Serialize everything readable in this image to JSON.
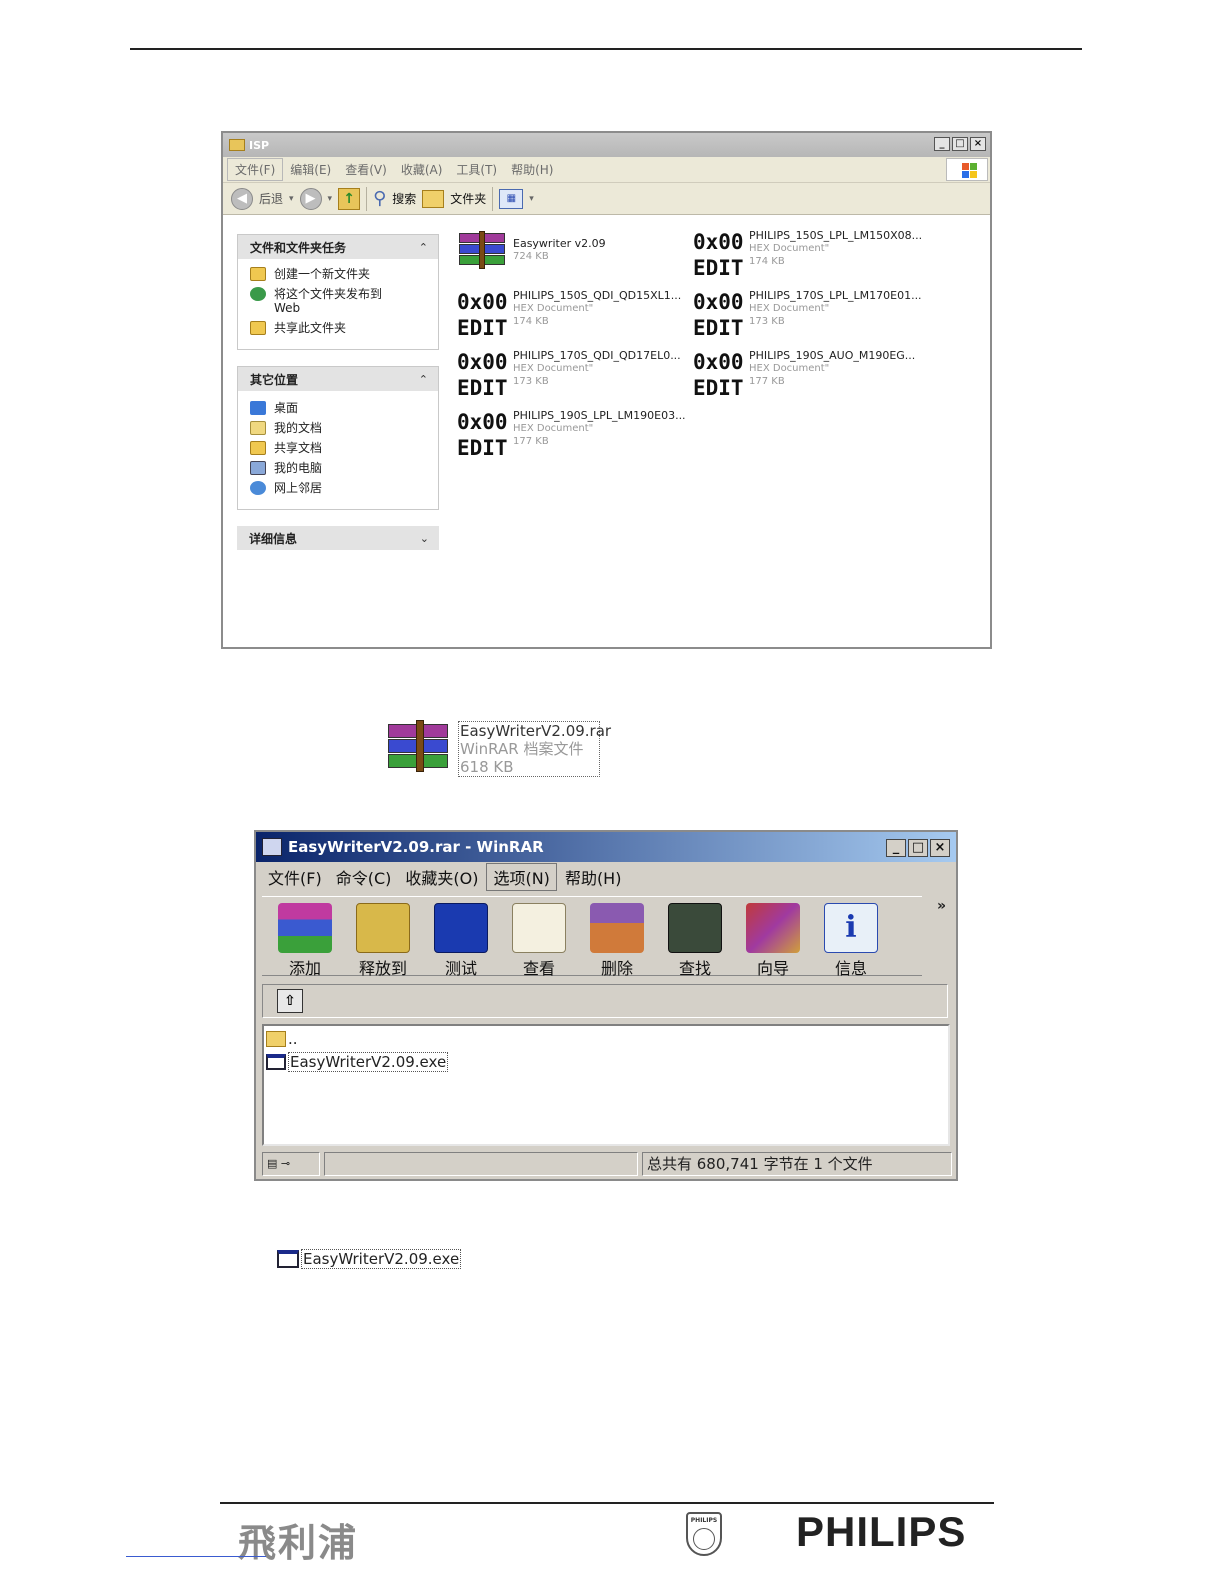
{
  "explorer": {
    "title": "ISP",
    "menu": [
      "文件(F)",
      "编辑(E)",
      "查看(V)",
      "收藏(A)",
      "工具(T)",
      "帮助(H)"
    ],
    "toolbar": {
      "back": "后退",
      "search": "搜索",
      "folders": "文件夹"
    },
    "panels": {
      "tasks": {
        "header": "文件和文件夹任务",
        "items": [
          "创建一个新文件夹",
          "将这个文件夹发布到",
          "Web",
          "共享此文件夹"
        ]
      },
      "places": {
        "header": "其它位置",
        "items": [
          "桌面",
          "我的文档",
          "共享文档",
          "我的电脑",
          "网上邻居"
        ]
      },
      "details": {
        "header": "详细信息"
      }
    },
    "hex_icon": {
      "top": "0x00",
      "bottom": "EDIT"
    },
    "files": [
      {
        "name": "Easywriter v2.09",
        "type": "",
        "size": "724 KB",
        "icon": "winrar-icon"
      },
      {
        "name": "PHILIPS_150S_LPL_LM150X08...",
        "type": "HEX Document\"",
        "size": "174 KB",
        "icon": "hex-icon"
      },
      {
        "name": "PHILIPS_150S_QDI_QD15XL1...",
        "type": "HEX Document\"",
        "size": "174 KB",
        "icon": "hex-icon"
      },
      {
        "name": "PHILIPS_170S_LPL_LM170E01...",
        "type": "HEX Document\"",
        "size": "173 KB",
        "icon": "hex-icon"
      },
      {
        "name": "PHILIPS_170S_QDI_QD17EL0...",
        "type": "HEX Document\"",
        "size": "173 KB",
        "icon": "hex-icon"
      },
      {
        "name": "PHILIPS_190S_AUO_M190EG...",
        "type": "HEX Document\"",
        "size": "177 KB",
        "icon": "hex-icon"
      },
      {
        "name": "PHILIPS_190S_LPL_LM190E03...",
        "type": "HEX Document\"",
        "size": "177 KB",
        "icon": "hex-icon"
      }
    ]
  },
  "rar_file": {
    "name": "EasyWriterV2.09.rar",
    "type": "WinRAR 档案文件",
    "size": "618 KB"
  },
  "winrar": {
    "title": "EasyWriterV2.09.rar - WinRAR",
    "menu": [
      "文件(F)",
      "命令(C)",
      "收藏夹(O)",
      "选项(N)",
      "帮助(H)"
    ],
    "toolbar": [
      "添加",
      "释放到",
      "测试",
      "查看",
      "删除",
      "查找",
      "向导",
      "信息"
    ],
    "more": "»",
    "list": [
      "..",
      "EasyWriterV2.09.exe"
    ],
    "status": "总共有 680,741 字节在 1 个文件"
  },
  "exe_file": {
    "name": "EasyWriterV2.09.exe"
  },
  "footer": {
    "cn_brand": "飛利浦",
    "shield_text": "PHILIPS",
    "brand": "PHILIPS"
  },
  "colors": {
    "winrar_title_start": "#0a246a",
    "winrar_title_end": "#a6caf0",
    "xp_face": "#ece9d8",
    "win_face": "#d4d0c8"
  }
}
